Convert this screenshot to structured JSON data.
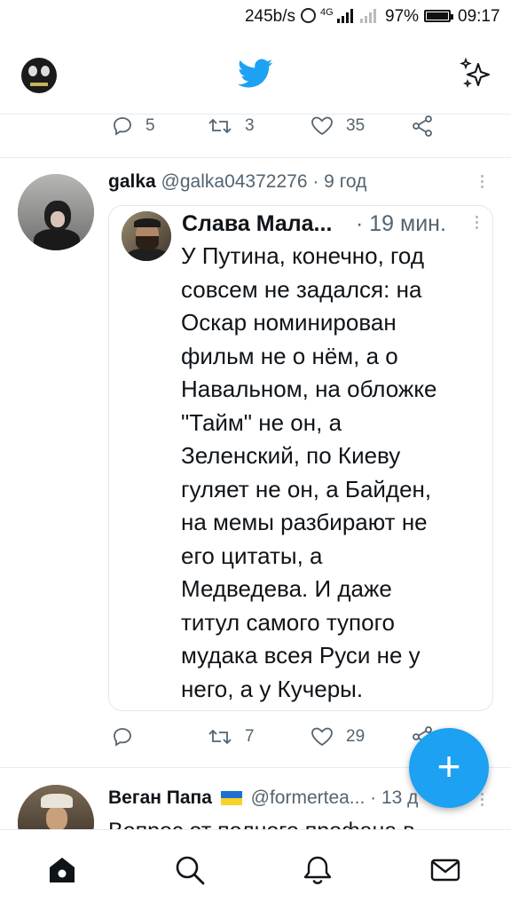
{
  "status_bar": {
    "speed": "245b/s",
    "network": "4G",
    "battery": "97%",
    "time": "09:17"
  },
  "header": {
    "avatar_icon": "profile-avatar",
    "logo_icon": "twitter-bird-icon",
    "sparkle_icon": "sparkle-icon"
  },
  "prev_tweet_actions": {
    "replies": "5",
    "retweets": "3",
    "likes": "35"
  },
  "tweet": {
    "name": "galka",
    "handle": "@galka04372276",
    "time": "· 9 год",
    "quote": {
      "name": "Слава Мала...",
      "time": "· 19 мин.",
      "text": "У Путина, конечно, год\nсовсем не задался: на\nОскар номинирован\nфильм не о нём, а о\nНавальном, на обложке\n\"Тайм\" не он, а\nЗеленский, по Киеву\nгуляет не он, а Байден,\nна мемы разбирают не\nего цитаты, а\nМедведева. И даже\nтитул самого тупого\nмудака всея Руси не у\nнего, а у Кучеры."
    },
    "actions": {
      "replies": "",
      "retweets": "7",
      "likes": "29"
    }
  },
  "fab": {
    "label": "+"
  },
  "tweet2": {
    "name": "Веган Папа",
    "handle": "@formertea...",
    "time": "· 13 д",
    "text": "Вопрос от полного профана в"
  },
  "bottom_nav": [
    "home-icon",
    "search-icon",
    "notifications-icon",
    "messages-icon"
  ],
  "colors": {
    "accent": "#1da1f2",
    "text": "#0f1419",
    "muted": "#536471"
  }
}
